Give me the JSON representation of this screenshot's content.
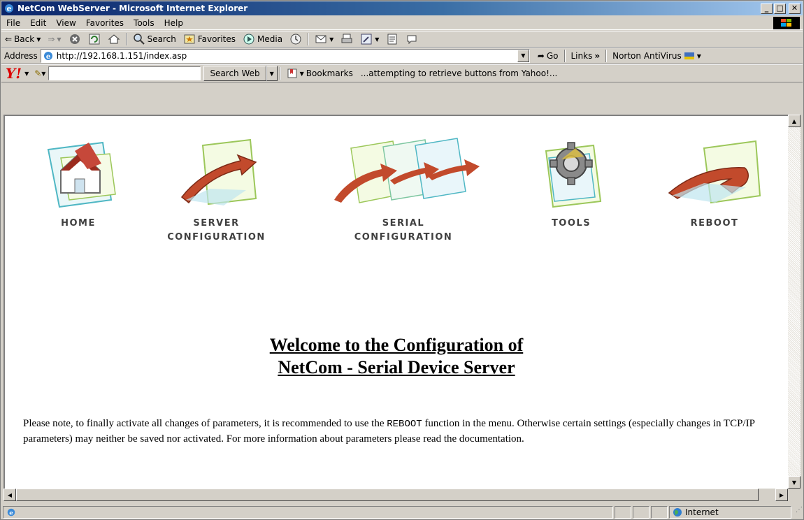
{
  "window": {
    "title": "NetCom WebServer - Microsoft Internet Explorer",
    "minimize": "_",
    "maximize": "□",
    "close": "✕"
  },
  "menu": [
    "File",
    "Edit",
    "View",
    "Favorites",
    "Tools",
    "Help"
  ],
  "toolbar": {
    "back": "Back",
    "search": "Search",
    "favorites": "Favorites",
    "media": "Media"
  },
  "address": {
    "label": "Address",
    "url": "http://192.168.1.151/index.asp",
    "go": "Go",
    "links": "Links",
    "links_chevron": "»",
    "norton": "Norton AntiVirus"
  },
  "yahoo": {
    "logo": "Y!",
    "search_button": "Search Web",
    "bookmarks": "Bookmarks",
    "status_text": "...attempting to retrieve buttons from Yahoo!..."
  },
  "nav": [
    {
      "id": "home",
      "line1": "HOME",
      "line2": ""
    },
    {
      "id": "server",
      "line1": "SERVER",
      "line2": "CONFIGURATION"
    },
    {
      "id": "serial",
      "line1": "SERIAL",
      "line2": "CONFIGURATION"
    },
    {
      "id": "tools",
      "line1": "TOOLS",
      "line2": ""
    },
    {
      "id": "reboot",
      "line1": "REBOOT",
      "line2": ""
    }
  ],
  "welcome": {
    "line1": "Welcome to the Configuration of",
    "line2": "NetCom - Serial Device Server"
  },
  "note": {
    "part1": "Please note, to finally activate all changes of parameters, it is recommended to use the ",
    "reboot": "REBOOT",
    "part2": " function in the menu. Otherwise certain settings (especially changes in TCP/IP parameters) may neither be saved nor activated. For more information about parameters please read the documentation."
  },
  "status": {
    "zone": "Internet"
  }
}
